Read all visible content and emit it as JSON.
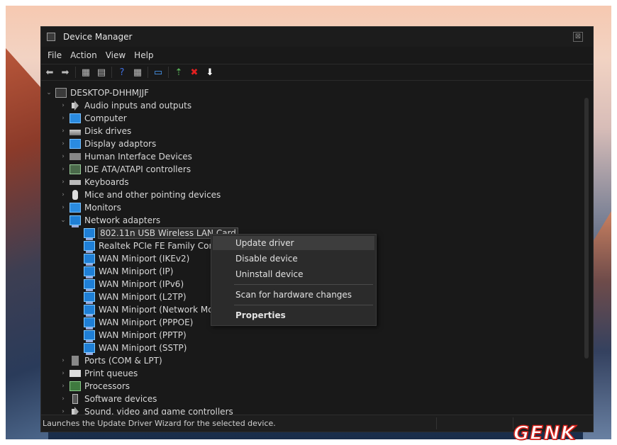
{
  "window": {
    "title": "Device Manager",
    "close_glyph": "⊠"
  },
  "menu": [
    "File",
    "Action",
    "View",
    "Help"
  ],
  "toolbar": [
    {
      "icon": "back-arrow-icon",
      "glyph": "⬅",
      "color": "#bbbbbb"
    },
    {
      "icon": "forward-arrow-icon",
      "glyph": "➡",
      "color": "#bbbbbb"
    },
    {
      "icon": "properties-icon",
      "glyph": "▦",
      "color": "#bbbbbb"
    },
    {
      "icon": "show-hidden-icon",
      "glyph": "▤",
      "color": "#bbbbbb"
    },
    {
      "icon": "help-icon",
      "glyph": "?",
      "color": "#3f6fe0"
    },
    {
      "icon": "show-devices-icon",
      "glyph": "▦",
      "color": "#bbbbbb"
    },
    {
      "icon": "monitor-icon",
      "glyph": "▭",
      "color": "#4aa0ff"
    },
    {
      "icon": "update-driver-icon",
      "glyph": "⇡",
      "color": "#5fbf5f"
    },
    {
      "icon": "uninstall-icon",
      "glyph": "✖",
      "color": "#e02020"
    },
    {
      "icon": "download-icon",
      "glyph": "⬇",
      "color": "#ffffff"
    }
  ],
  "tree": {
    "root": "DESKTOP-DHHMJJF",
    "categories": [
      {
        "label": "Audio inputs and outputs",
        "icon": "speaker"
      },
      {
        "label": "Computer",
        "icon": "monitor"
      },
      {
        "label": "Disk drives",
        "icon": "disk"
      },
      {
        "label": "Display adaptors",
        "icon": "monitor"
      },
      {
        "label": "Human Interface Devices",
        "icon": "hid"
      },
      {
        "label": "IDE ATA/ATAPI controllers",
        "icon": "ide"
      },
      {
        "label": "Keyboards",
        "icon": "kbd"
      },
      {
        "label": "Mice and other pointing devices",
        "icon": "mouse"
      },
      {
        "label": "Monitors",
        "icon": "monitor"
      },
      {
        "label": "Network adapters",
        "icon": "net"
      }
    ],
    "network_children": [
      "802.11n USB Wireless LAN Card",
      "Realtek PCIe FE Family Contro",
      "WAN Miniport (IKEv2)",
      "WAN Miniport (IP)",
      "WAN Miniport (IPv6)",
      "WAN Miniport (L2TP)",
      "WAN Miniport (Network Mon",
      "WAN Miniport (PPPOE)",
      "WAN Miniport (PPTP)",
      "WAN Miniport (SSTP)"
    ],
    "after": [
      {
        "label": "Ports (COM & LPT)",
        "icon": "port"
      },
      {
        "label": "Print queues",
        "icon": "printer"
      },
      {
        "label": "Processors",
        "icon": "cpu"
      },
      {
        "label": "Software devices",
        "icon": "soft"
      },
      {
        "label": "Sound, video and game controllers",
        "icon": "speaker"
      }
    ]
  },
  "context_menu": {
    "update": "Update driver",
    "disable": "Disable device",
    "uninstall": "Uninstall device",
    "scan": "Scan for hardware changes",
    "properties": "Properties"
  },
  "status": "Launches the Update Driver Wizard for the selected device.",
  "logo": "GENK"
}
